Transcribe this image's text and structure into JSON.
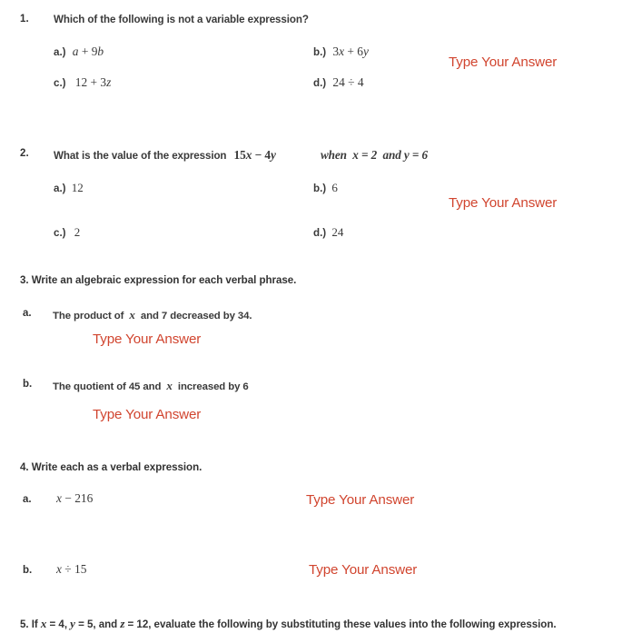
{
  "document": {
    "type": "math-worksheet",
    "background_color": "#ffffff",
    "text_color": "#3a3a3a",
    "answer_prompt_color": "#d1452f",
    "answer_prompt_label": "Type Your Answer"
  },
  "questions": [
    {
      "number": "1.",
      "stem": "Which of the following is not a variable expression?",
      "options": [
        {
          "label": "a.)",
          "expression": "a + 9b"
        },
        {
          "label": "b.)",
          "expression": "3x + 6y"
        },
        {
          "label": "c.)",
          "expression": "12 + 3z"
        },
        {
          "label": "d.)",
          "expression": "24 ÷ 4"
        }
      ],
      "answer_prompt": "Type Your Answer"
    },
    {
      "number": "2.",
      "stem": "What is the value of the expression",
      "stem_expression": "15x − 4y",
      "stem_condition": "when x = 2  and y = 6",
      "options": [
        {
          "label": "a.)",
          "expression": "12"
        },
        {
          "label": "b.)",
          "expression": "6"
        },
        {
          "label": "c.)",
          "expression": "2"
        },
        {
          "label": "d.)",
          "expression": "24"
        }
      ],
      "answer_prompt": "Type Your Answer"
    },
    {
      "number": "3.",
      "heading": "3. Write an algebraic expression for each verbal phrase.",
      "parts": [
        {
          "label": "a.",
          "text_before": "The product of",
          "variable": "x",
          "text_after": "and 7 decreased by 34.",
          "answer_prompt": "Type Your Answer"
        },
        {
          "label": "b.",
          "text_before": "The quotient of 45 and",
          "variable": "x",
          "text_after": "increased by 6",
          "answer_prompt": "Type Your Answer"
        }
      ]
    },
    {
      "number": "4.",
      "heading": "4. Write each as a verbal expression.",
      "parts": [
        {
          "label": "a.",
          "expression": "x − 216",
          "answer_prompt": "Type Your Answer"
        },
        {
          "label": "b.",
          "expression": "x ÷ 15",
          "answer_prompt": "Type Your Answer"
        }
      ]
    },
    {
      "number": "5.",
      "heading": "5. If x = 4, y = 5, and z = 12, evaluate the following by substituting these values into the following expression."
    }
  ]
}
